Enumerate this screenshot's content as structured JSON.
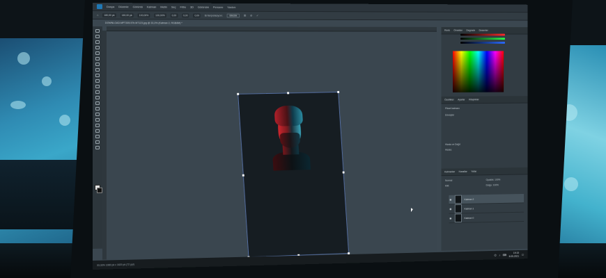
{
  "menu": {
    "items": [
      "Dosya",
      "Düzenle",
      "Görüntü",
      "Katman",
      "Metin",
      "Seç",
      "Filtre",
      "3D",
      "Görünüm",
      "Pencere",
      "Yardım"
    ]
  },
  "options": {
    "x_value": "180,00 pk",
    "y_value": "180,00 pk",
    "w_value": "100,00%",
    "h_value": "100,00%",
    "angle_value": "0,00",
    "h_skew": "0,00",
    "v_skew": "0,00",
    "interpolation_label": "Enterpolasyon:",
    "interpolation_value": "Bikübik"
  },
  "document": {
    "tab_label": "DOWNLOAD.MPT305.57b.M7123.jpg @ 33,3% (Katman 2, RGB/8#) *"
  },
  "panels": {
    "top_tabs": [
      "Renk",
      "Örnekler",
      "Degrade",
      "Desenler"
    ],
    "mid_tabs": [
      "Özellikler",
      "Ayarlar",
      "Kitaplıklar"
    ],
    "properties": {
      "section1": "Piksel katmanı",
      "section2": "Dönüştür",
      "section3": "Hizala ve Dağıt",
      "section4": "Hizala:"
    },
    "layers_tabs": [
      "Katmanlar",
      "Kanallar",
      "Yollar"
    ],
    "blend_mode": "Normal",
    "opacity": "Opaklık: 100%",
    "fill": "Dolgu: 100%",
    "lock_label": "Kilit:",
    "layers": [
      {
        "name": "Katman 2",
        "selected": true
      },
      {
        "name": "Katman 1",
        "selected": false
      },
      {
        "name": "Katman 0",
        "selected": false
      }
    ]
  },
  "status": {
    "zoom": "33,33%",
    "doc_size": "1080 pk x 1620 pk (72 ppi)"
  },
  "taskbar": {
    "time": "19:15",
    "date": "8.05.2021"
  }
}
